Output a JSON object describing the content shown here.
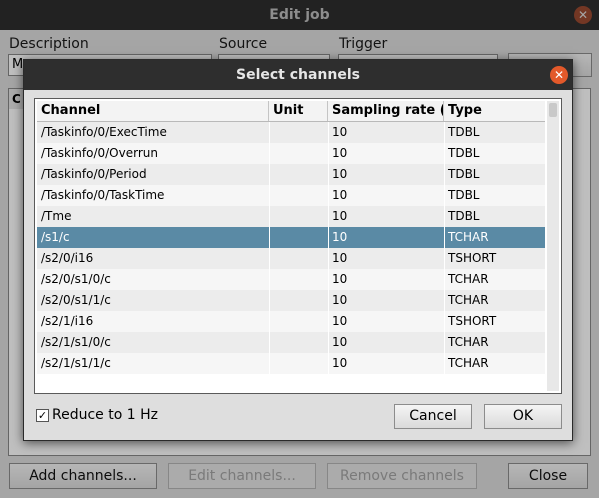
{
  "parent_window": {
    "title": "Edit job",
    "close_glyph": "✕",
    "description_label": "Description",
    "description_value": "M",
    "source_label": "Source",
    "trigger_label": "Trigger",
    "dots_label": "...",
    "list_header_initial": "C",
    "buttons": {
      "add_channels": "Add channels...",
      "edit_channels": "Edit channels...",
      "remove_channels": "Remove channels",
      "close": "Close"
    }
  },
  "dialog": {
    "title": "Select channels",
    "close_glyph": "✕",
    "columns": [
      "Channel",
      "Unit",
      "Sampling rate (I",
      "Type"
    ],
    "rows": [
      {
        "channel": "/Taskinfo/0/ExecTime",
        "unit": "",
        "rate": "10",
        "type": "TDBL"
      },
      {
        "channel": "/Taskinfo/0/Overrun",
        "unit": "",
        "rate": "10",
        "type": "TDBL"
      },
      {
        "channel": "/Taskinfo/0/Period",
        "unit": "",
        "rate": "10",
        "type": "TDBL"
      },
      {
        "channel": "/Taskinfo/0/TaskTime",
        "unit": "",
        "rate": "10",
        "type": "TDBL"
      },
      {
        "channel": "/Tme",
        "unit": "",
        "rate": "10",
        "type": "TDBL"
      },
      {
        "channel": "/s1/c",
        "unit": "",
        "rate": "10",
        "type": "TCHAR"
      },
      {
        "channel": "/s2/0/i16",
        "unit": "",
        "rate": "10",
        "type": "TSHORT"
      },
      {
        "channel": "/s2/0/s1/0/c",
        "unit": "",
        "rate": "10",
        "type": "TCHAR"
      },
      {
        "channel": "/s2/0/s1/1/c",
        "unit": "",
        "rate": "10",
        "type": "TCHAR"
      },
      {
        "channel": "/s2/1/i16",
        "unit": "",
        "rate": "10",
        "type": "TSHORT"
      },
      {
        "channel": "/s2/1/s1/0/c",
        "unit": "",
        "rate": "10",
        "type": "TCHAR"
      },
      {
        "channel": "/s2/1/s1/1/c",
        "unit": "",
        "rate": "10",
        "type": "TCHAR"
      }
    ],
    "selected_row": 5,
    "reduce_checkbox": {
      "label": "Reduce to 1 Hz",
      "checked": true,
      "glyph": "✓"
    },
    "cancel_label": "Cancel",
    "ok_label": "OK"
  }
}
